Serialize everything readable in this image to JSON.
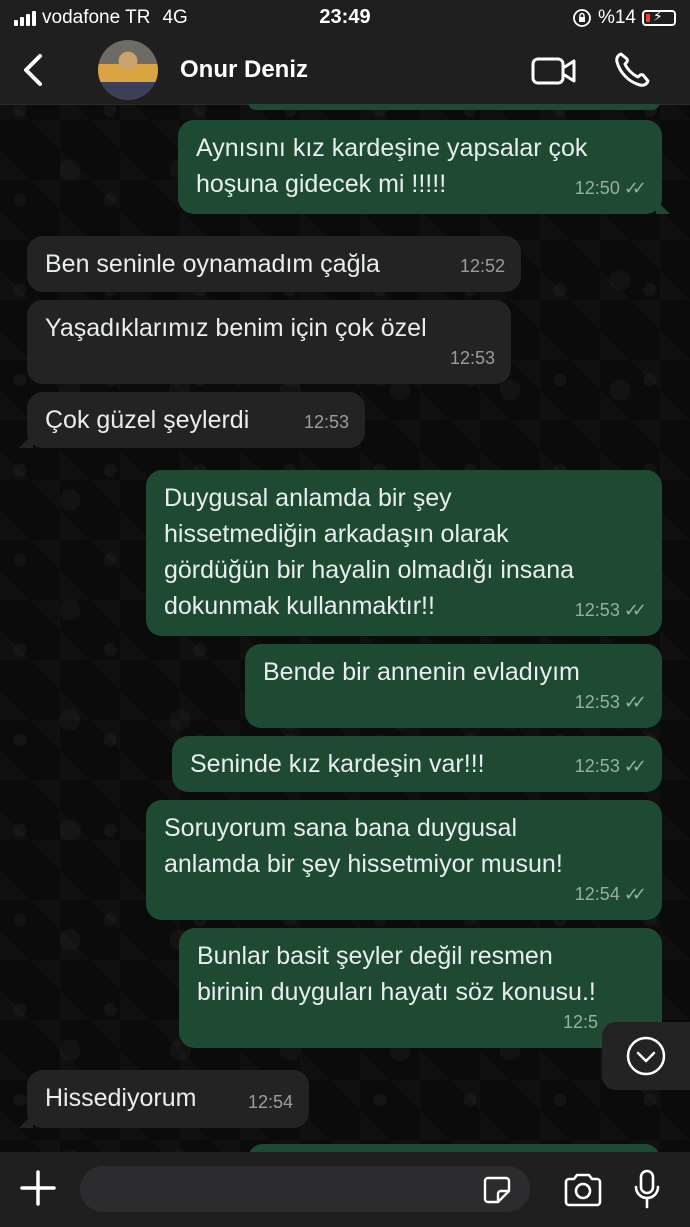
{
  "status_bar": {
    "carrier": "vodafone TR",
    "network": "4G",
    "time": "23:49",
    "battery": "%14",
    "battery_level": 0.14
  },
  "header": {
    "contact_name": "Onur Deniz",
    "icons": [
      "back-icon",
      "video-call-icon",
      "phone-icon"
    ]
  },
  "messages": [
    {
      "direction": "out",
      "text": "Aynısını kız kardeşine yapsalar çok\nhoşuna gidecek mi !!!!!",
      "time": "12:50",
      "read": true
    },
    {
      "direction": "in",
      "text": "Ben seninle oynamadım çağla",
      "time": "12:52"
    },
    {
      "direction": "in",
      "text": "Yaşadıklarımız benim için çok özel",
      "time": "12:53"
    },
    {
      "direction": "in",
      "text": "Çok güzel şeylerdi",
      "time": "12:53"
    },
    {
      "direction": "out",
      "text": "Duygusal anlamda bir şey\nhissetmediğin arkadaşın olarak\ngördüğün bir hayalin olmadığı insana\ndokunmak kullanmaktır!!",
      "time": "12:53",
      "read": true
    },
    {
      "direction": "out",
      "text": "Bende bir annenin evladıyım",
      "time": "12:53",
      "read": true
    },
    {
      "direction": "out",
      "text": "Seninde kız kardeşin var!!!",
      "time": "12:53",
      "read": true
    },
    {
      "direction": "out",
      "text": "Soruyorum sana bana duygusal\nanlamda bir şey hissetmiyor musun!",
      "time": "12:54",
      "read": true
    },
    {
      "direction": "out",
      "text": "Bunlar basit şeyler değil resmen\nbirinin duyguları hayatı söz konusu.!",
      "time": "12:5",
      "read": true
    },
    {
      "direction": "in",
      "text": "Hissediyorum",
      "time": "12:54"
    }
  ],
  "input_bar": {
    "placeholder": "",
    "icons": [
      "plus-icon",
      "sticker-icon",
      "camera-icon",
      "microphone-icon"
    ]
  },
  "colors": {
    "outgoing_bubble": "#1d4a30",
    "incoming_bubble": "#232323",
    "background": "#0b0b0b",
    "bars": "#1f1f1f"
  }
}
